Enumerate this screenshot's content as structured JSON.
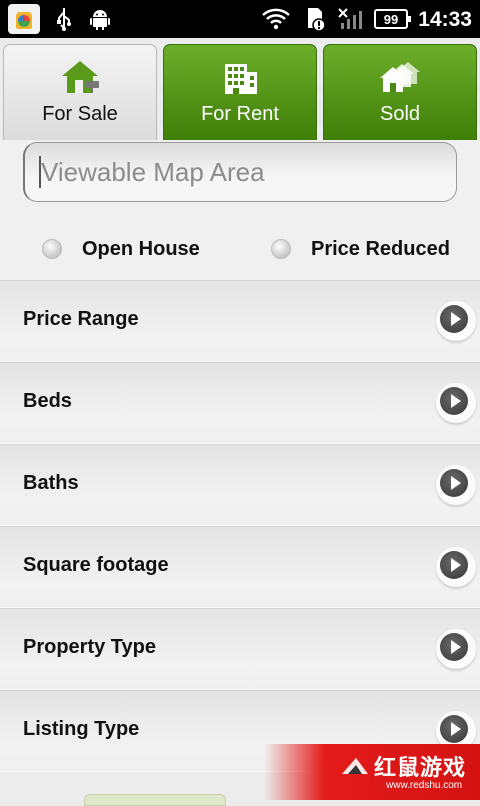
{
  "statusbar": {
    "battery": "99",
    "time": "14:33"
  },
  "tabs": [
    {
      "label": "For Sale",
      "icon": "house-icon",
      "active": true
    },
    {
      "label": "For Rent",
      "icon": "building-icon",
      "active": false
    },
    {
      "label": "Sold",
      "icon": "houses-icon",
      "active": false
    }
  ],
  "search": {
    "placeholder": "Viewable Map Area"
  },
  "options": {
    "open_house": "Open House",
    "price_reduced": "Price Reduced"
  },
  "filters": [
    "Price Range",
    "Beds",
    "Baths",
    "Square footage",
    "Property Type",
    "Listing Type"
  ],
  "watermark": {
    "text": "红鼠游戏",
    "url": "www.redshu.com"
  },
  "colors": {
    "tab_green": "#5a9a1a",
    "watermark_red": "#e31b1b"
  }
}
